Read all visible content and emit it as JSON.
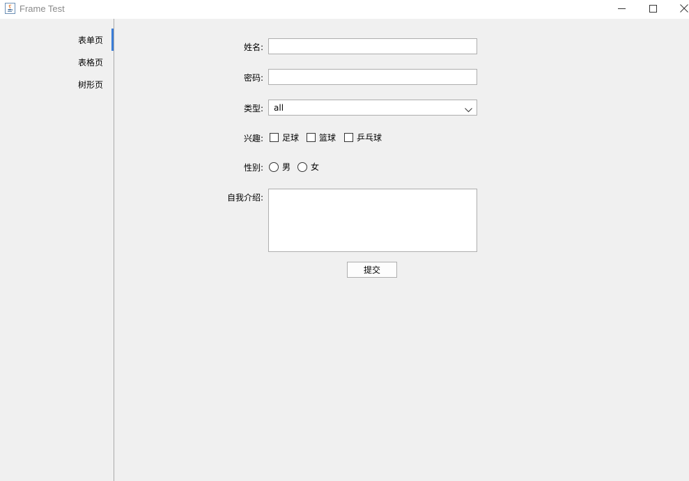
{
  "window": {
    "title": "Frame Test",
    "icon": "java-cup-icon"
  },
  "tabs": [
    {
      "label": "表单页",
      "selected": true
    },
    {
      "label": "表格页",
      "selected": false
    },
    {
      "label": "树形页",
      "selected": false
    }
  ],
  "form": {
    "name": {
      "label": "姓名:",
      "value": ""
    },
    "password": {
      "label": "密码:",
      "value": ""
    },
    "type": {
      "label": "类型:",
      "selected": "all"
    },
    "interests": {
      "label": "兴趣:",
      "options": [
        {
          "label": "足球",
          "checked": false
        },
        {
          "label": "篮球",
          "checked": false
        },
        {
          "label": "乒乓球",
          "checked": false
        }
      ]
    },
    "gender": {
      "label": "性别:",
      "options": [
        {
          "label": "男",
          "selected": false
        },
        {
          "label": "女",
          "selected": false
        }
      ]
    },
    "intro": {
      "label": "自我介绍:",
      "value": ""
    },
    "submit_label": "提交"
  },
  "colors": {
    "tab_accent": "#3b7dd8",
    "background": "#f0f0f0"
  }
}
